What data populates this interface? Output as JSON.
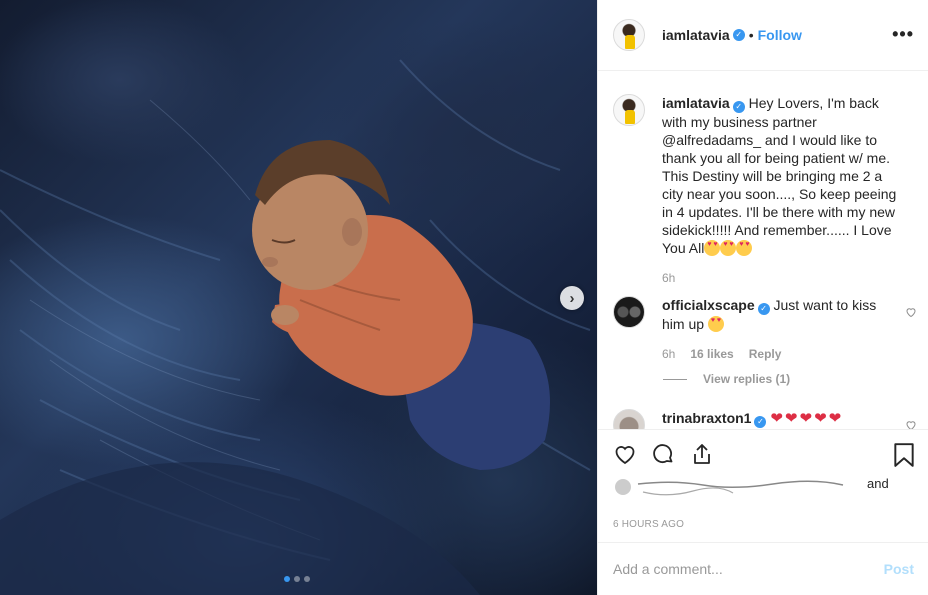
{
  "post": {
    "author": "iamlatavia",
    "separator": "•",
    "follow_label": "Follow",
    "more_label": "•••",
    "photo_alt": "",
    "carousel_next": "›",
    "carousel_total": 3
  },
  "caption": {
    "username": "iamlatavia",
    "text": "Hey Lovers, I'm back with my business partner @alfredadams_ and I would like to thank you all for being patient w/ me. This Destiny will be bringing me 2 a city near you soon...., So keep peeing in 4 updates. I'll be there with my new sidekick!!!!! And remember...... I Love You All",
    "time": "6h"
  },
  "comments": [
    {
      "username": "officialxscape",
      "text": "Just want to kiss him up",
      "time": "6h",
      "likes": "16 likes",
      "reply_label": "Reply",
      "view_replies": "View replies (1)"
    },
    {
      "username": "trinabraxton1",
      "hearts": "❤❤❤❤❤"
    }
  ],
  "likes_suffix": "and",
  "timestamp": "6 HOURS AGO",
  "add_comment": {
    "placeholder": "Add a comment...",
    "post_label": "Post"
  },
  "colors": {
    "accent": "#3897f0",
    "post_disabled": "#b2dffc",
    "secondary_text": "#999999"
  }
}
